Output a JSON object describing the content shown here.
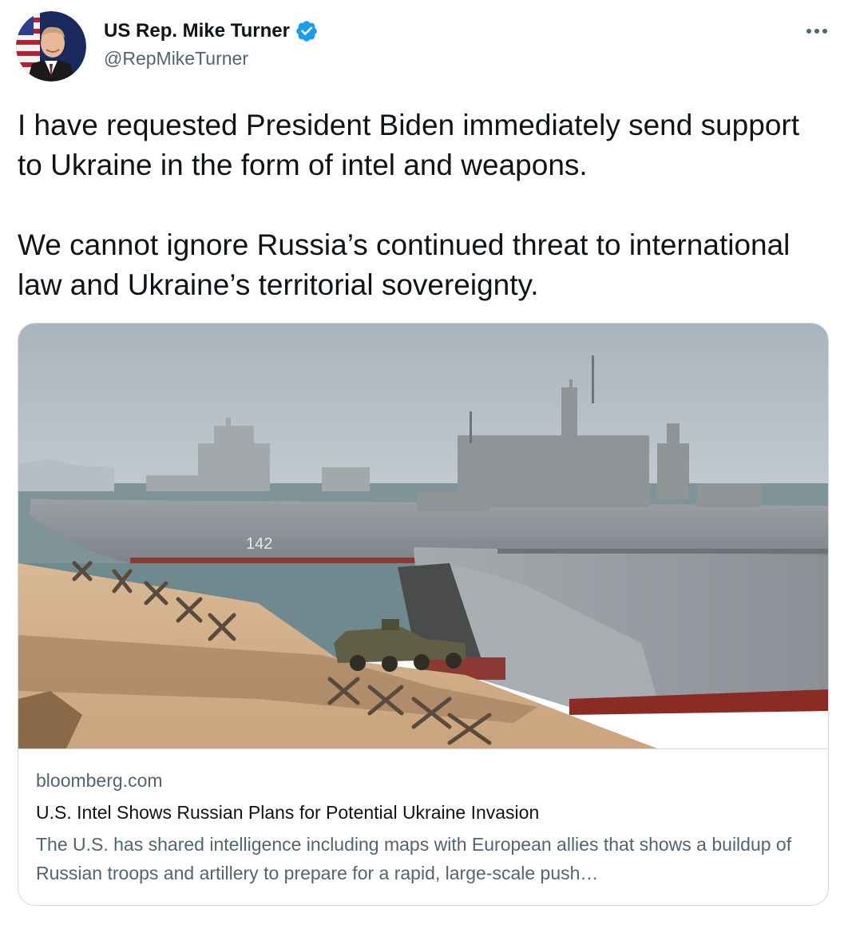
{
  "author": {
    "name": "US Rep. Mike Turner",
    "handle": "@RepMikeTurner",
    "verified": true,
    "verified_color": "#1d9bf0"
  },
  "icons": {
    "more": "more-horizontal-icon",
    "verified": "verified-badge-icon"
  },
  "tweet": {
    "paragraphs": [
      "I have requested President Biden immediately send support to Ukraine in the form of intel and weapons.",
      "We cannot ignore Russia’s continued threat to international law and Ukraine’s territorial sovereignty."
    ]
  },
  "card": {
    "image_hull_number": "142",
    "domain": "bloomberg.com",
    "title": "U.S. Intel Shows Russian Plans for Potential Ukraine Invasion",
    "description": "The U.S. has shared intelligence including maps with European allies that shows a buildup of Russian troops and artillery to prepare for a rapid, large-scale push…"
  },
  "colors": {
    "text_primary": "#0f1419",
    "text_secondary": "#536471",
    "border": "#cfd9de"
  }
}
